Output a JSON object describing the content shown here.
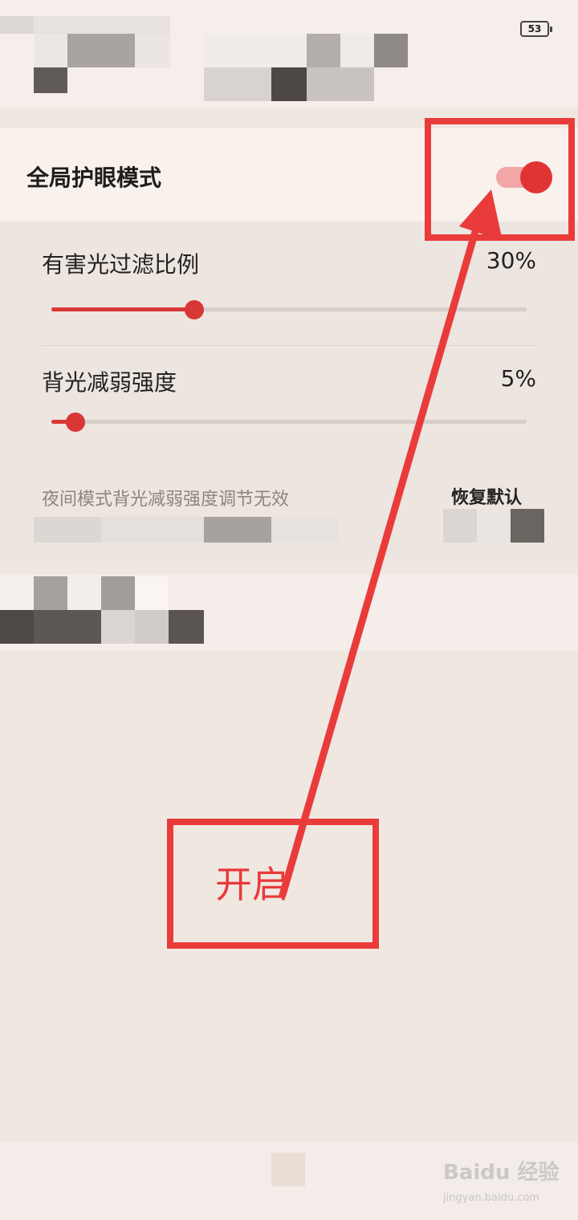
{
  "status_bar": {
    "battery_level": "53"
  },
  "eye_care": {
    "title": "全局护眼模式",
    "enabled": true
  },
  "settings": {
    "harmful_light": {
      "label": "有害光过滤比例",
      "value_text": "30%",
      "value": 30
    },
    "backlight": {
      "label": "背光减弱强度",
      "value_text": "5%",
      "value": 5
    },
    "hint": "夜间模式背光减弱强度调节无效",
    "restore_default": "恢复默认"
  },
  "annotation": {
    "label": "开启",
    "color": "#ea3b3b"
  },
  "watermark": {
    "main": "Baidu 经验",
    "sub": "jingyan.baidu.com"
  },
  "colors": {
    "accent": "#d93636",
    "toggle_track": "#f2a6a6"
  }
}
